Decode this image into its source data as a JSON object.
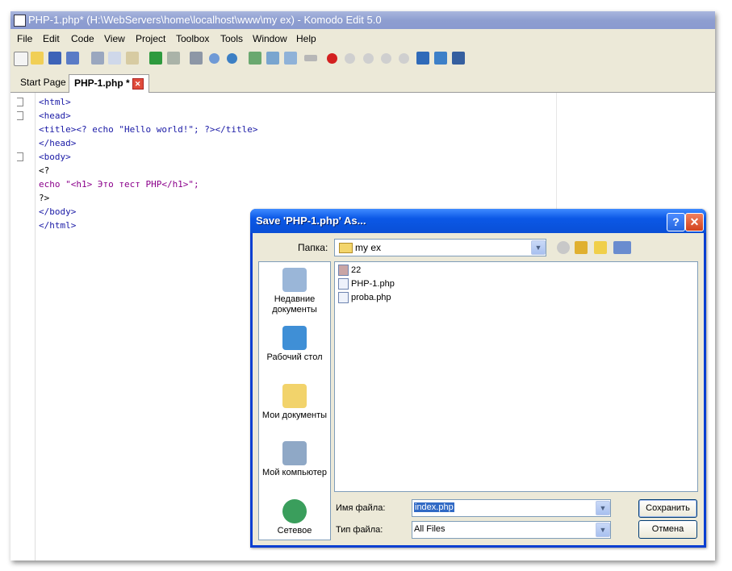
{
  "window": {
    "title": "PHP-1.php* (H:\\WebServers\\home\\localhost\\www\\my ex) - Komodo Edit 5.0"
  },
  "menu": [
    "File",
    "Edit",
    "Code",
    "View",
    "Project",
    "Toolbox",
    "Tools",
    "Window",
    "Help"
  ],
  "tabs": [
    {
      "label": "Start Page"
    },
    {
      "label": "PHP-1.php *"
    }
  ],
  "code_lines": [
    "<html>",
    "<head>",
    "<title><? echo \"Hello world!\"; ?></title>",
    "</head>",
    "<body>",
    "<?",
    "echo \"<h1> Это тест PHP</h1>\";",
    "?>",
    "</body>",
    "</html>"
  ],
  "dialog": {
    "title": "Save 'PHP-1.php' As...",
    "help_label": "?",
    "close_label": "✕",
    "lookin_label": "Папка:",
    "lookin_value": "my ex",
    "places": [
      {
        "label": "Недавние документы"
      },
      {
        "label": "Рабочий стол"
      },
      {
        "label": "Мои документы"
      },
      {
        "label": "Мой компьютер"
      },
      {
        "label": "Сетевое"
      }
    ],
    "files": [
      "22",
      "PHP-1.php",
      "proba.php"
    ],
    "filename_label": "Имя файла:",
    "filename_value": "index.php",
    "filetype_label": "Тип файла:",
    "filetype_value": "All Files",
    "save_label": "Сохранить",
    "cancel_label": "Отмена"
  }
}
